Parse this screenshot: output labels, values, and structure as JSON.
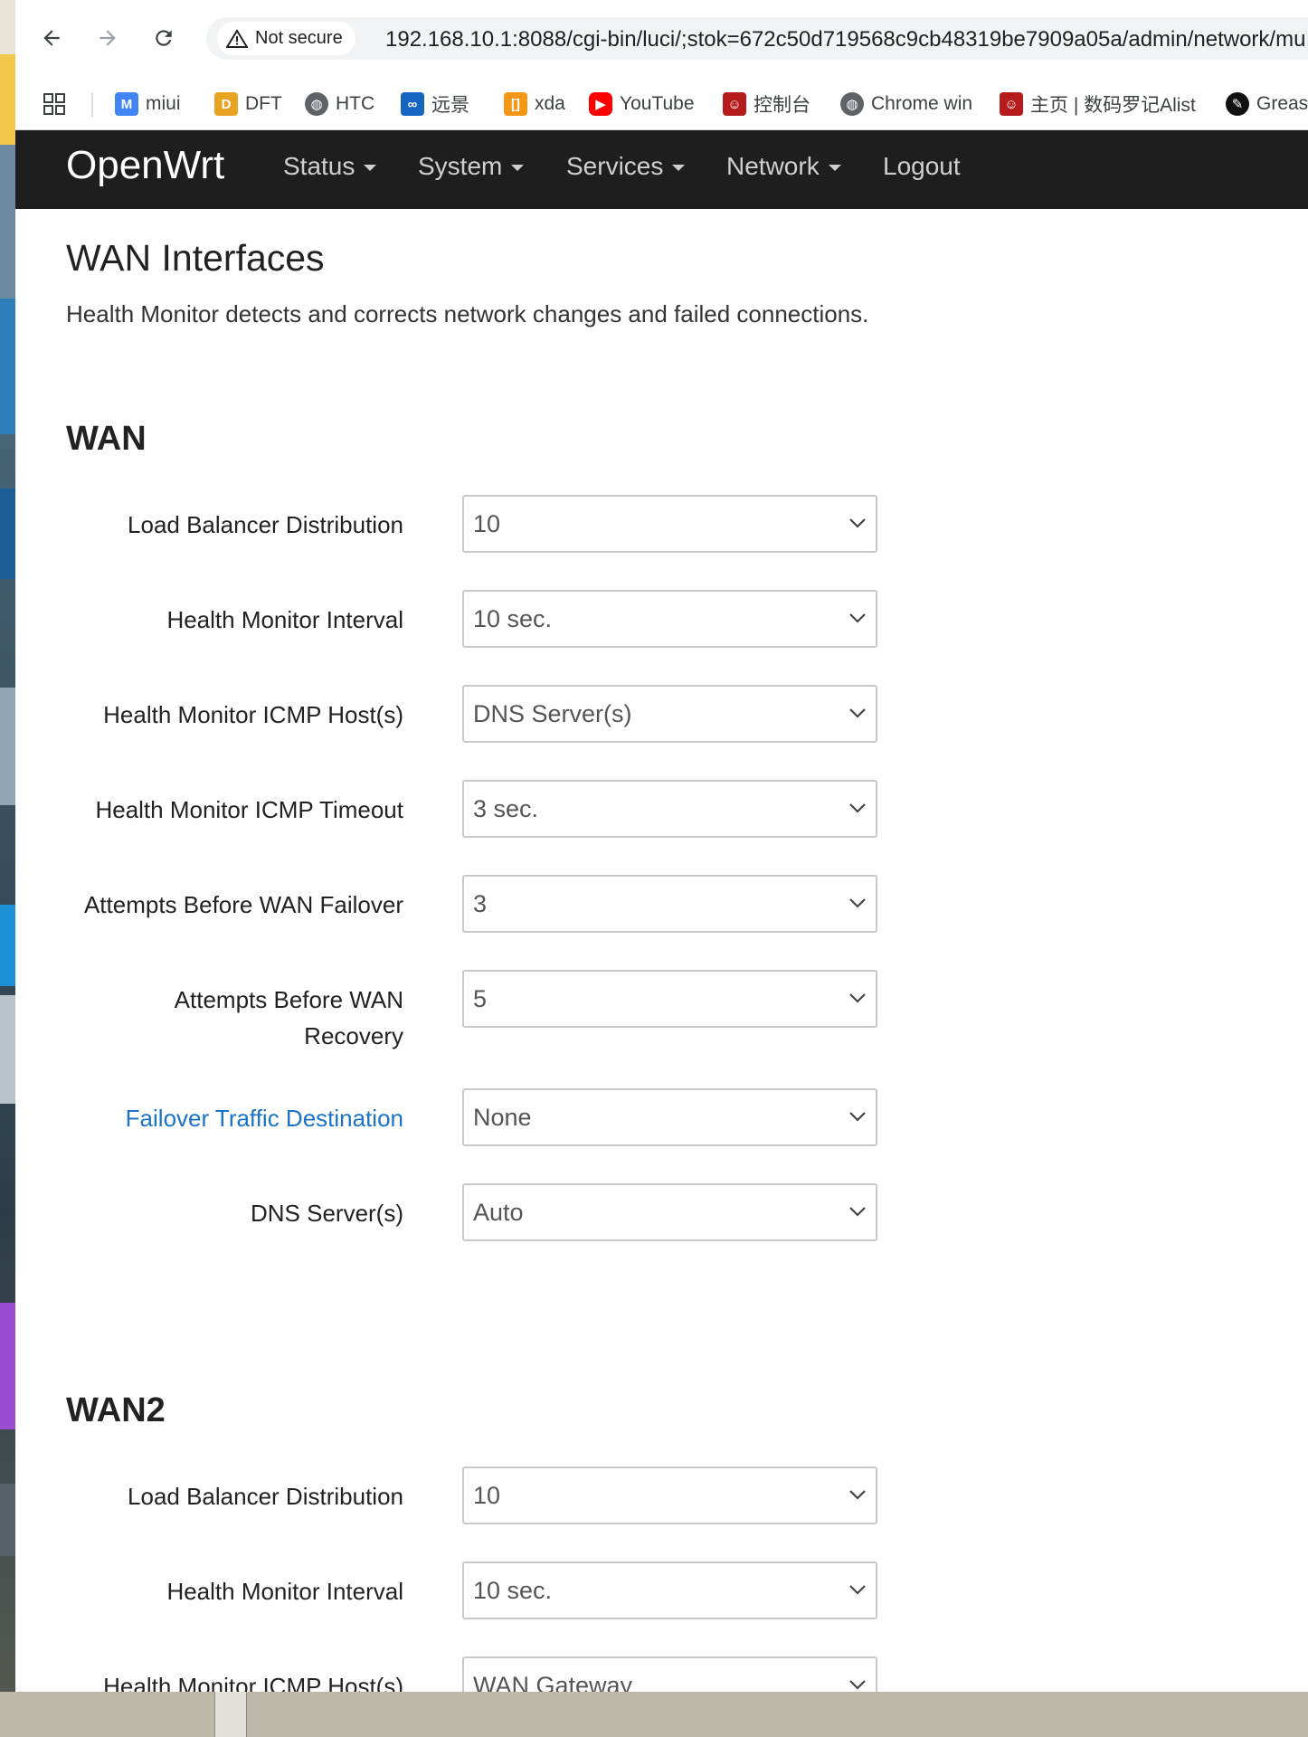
{
  "browser": {
    "security_label": "Not secure",
    "url": "192.168.10.1:8088/cgi-bin/luci/;stok=672c50d719568c9cb48319be7909a05a/admin/network/mu",
    "bookmarks": [
      {
        "label": "miui",
        "icon": "miui-icon",
        "color": "#4285f4"
      },
      {
        "label": "DFT",
        "icon": "dft-icon",
        "color": "#e8a323"
      },
      {
        "label": "HTC",
        "icon": "globe-icon",
        "color": "#5f6368"
      },
      {
        "label": "远景",
        "icon": "pcbeta-icon",
        "color": "#1565c0"
      },
      {
        "label": "xda",
        "icon": "xda-icon",
        "color": "#f59714"
      },
      {
        "label": "YouTube",
        "icon": "youtube-icon",
        "color": "#ff0000"
      },
      {
        "label": "控制台",
        "icon": "avatar-icon",
        "color": "#b71c1c"
      },
      {
        "label": "Chrome win",
        "icon": "globe-icon",
        "color": "#5f6368"
      },
      {
        "label": "主页 | 数码罗记Alist",
        "icon": "avatar-icon",
        "color": "#b71c1c"
      },
      {
        "label": "Greas",
        "icon": "greasyfork-icon",
        "color": "#111111"
      }
    ]
  },
  "openwrt": {
    "brand": "OpenWrt",
    "menu": [
      "Status",
      "System",
      "Services",
      "Network",
      "Logout"
    ],
    "page_title": "WAN Interfaces",
    "page_desc": "Health Monitor detects and corrects network changes and failed connections."
  },
  "sections": [
    {
      "title": "WAN",
      "fields": [
        {
          "label": "Load Balancer Distribution",
          "value": "10"
        },
        {
          "label": "Health Monitor Interval",
          "value": "10 sec."
        },
        {
          "label": "Health Monitor ICMP Host(s)",
          "value": "DNS Server(s)"
        },
        {
          "label": "Health Monitor ICMP Timeout",
          "value": "3 sec."
        },
        {
          "label": "Attempts Before WAN Failover",
          "value": "3"
        },
        {
          "label_line1": "Attempts Before WAN",
          "label_line2": "Recovery",
          "value": "5"
        },
        {
          "label": "Failover Traffic Destination",
          "value": "None"
        },
        {
          "label": "DNS Server(s)",
          "value": "Auto"
        }
      ]
    },
    {
      "title": "WAN2",
      "fields": [
        {
          "label": "Load Balancer Distribution",
          "value": "10"
        },
        {
          "label": "Health Monitor Interval",
          "value": "10 sec."
        },
        {
          "label": "Health Monitor ICMP Host(s)",
          "value": "WAN Gateway"
        }
      ]
    }
  ],
  "colors": {
    "topbar": "#1e1e1e",
    "link": "#1a73c9"
  }
}
